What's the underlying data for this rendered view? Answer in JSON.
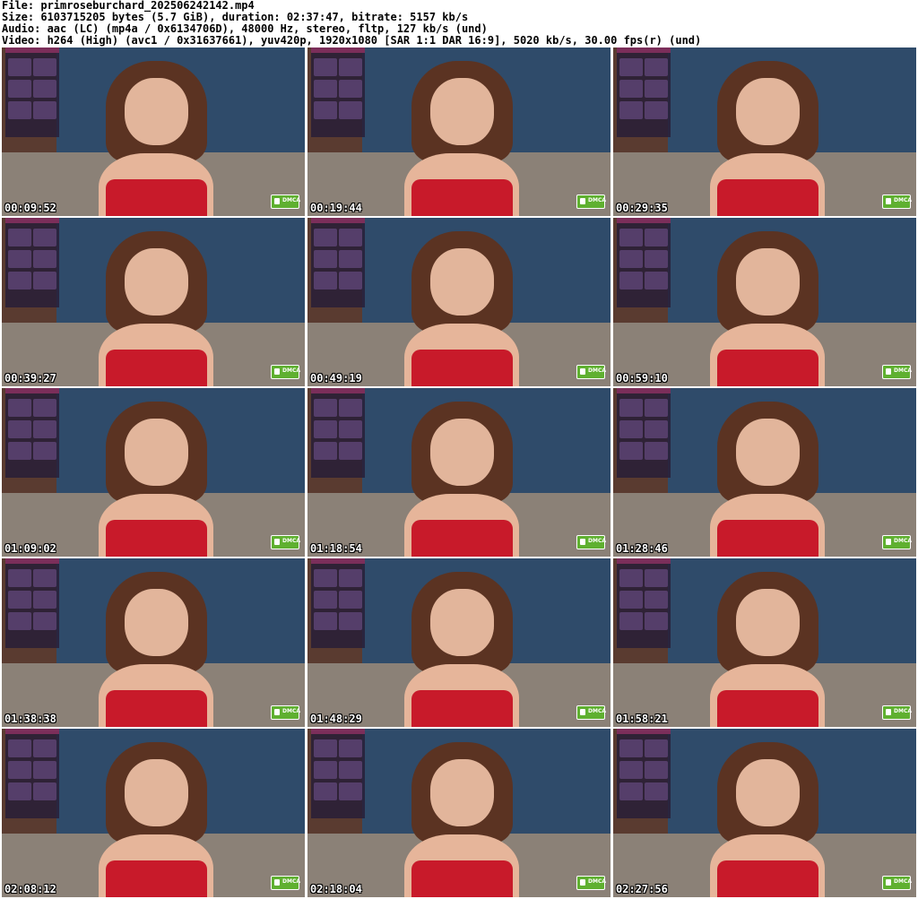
{
  "meta": {
    "file": "File: primroseburchard_202506242142.mp4",
    "size": "Size: 6103715205 bytes (5.7 GiB), duration: 02:37:47, bitrate: 5157 kb/s",
    "audio": "Audio: aac (LC) (mp4a / 0x6134706D), 48000 Hz, stereo, fltp, 127 kb/s (und)",
    "video": "Video: h264 (High) (avc1 / 0x31637661), yuv420p, 1920x1080 [SAR 1:1 DAR 16:9], 5020 kb/s, 30.00 fps(r) (und)"
  },
  "thumbnails": [
    {
      "timestamp": "00:09:52"
    },
    {
      "timestamp": "00:19:44"
    },
    {
      "timestamp": "00:29:35"
    },
    {
      "timestamp": "00:39:27"
    },
    {
      "timestamp": "00:49:19"
    },
    {
      "timestamp": "00:59:10"
    },
    {
      "timestamp": "01:09:02"
    },
    {
      "timestamp": "01:18:54"
    },
    {
      "timestamp": "01:28:46"
    },
    {
      "timestamp": "01:38:38"
    },
    {
      "timestamp": "01:48:29"
    },
    {
      "timestamp": "01:58:21"
    },
    {
      "timestamp": "02:08:12"
    },
    {
      "timestamp": "02:18:04"
    },
    {
      "timestamp": "02:27:56"
    }
  ],
  "watermark": {
    "label": "DMCA"
  }
}
